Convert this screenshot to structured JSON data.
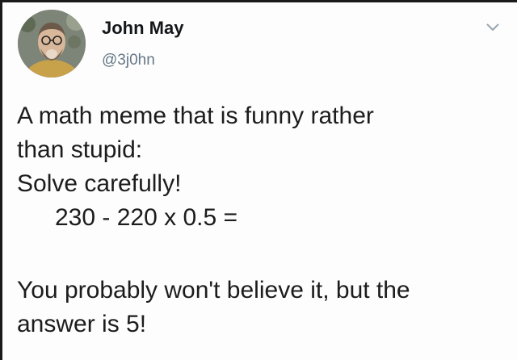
{
  "author": {
    "display_name": "John May",
    "handle": "@3j0hn"
  },
  "icons": {
    "avatar": "user-avatar-photo",
    "caret": "chevron-down-icon"
  },
  "colors": {
    "handle": "#657786",
    "text": "#14171a"
  },
  "tweet": {
    "lines": [
      "A math meme that is funny rather",
      "than stupid:",
      "Solve carefully!",
      "230 - 220 x 0.5 =",
      "You probably won't believe it, but the",
      "answer is 5!"
    ]
  }
}
